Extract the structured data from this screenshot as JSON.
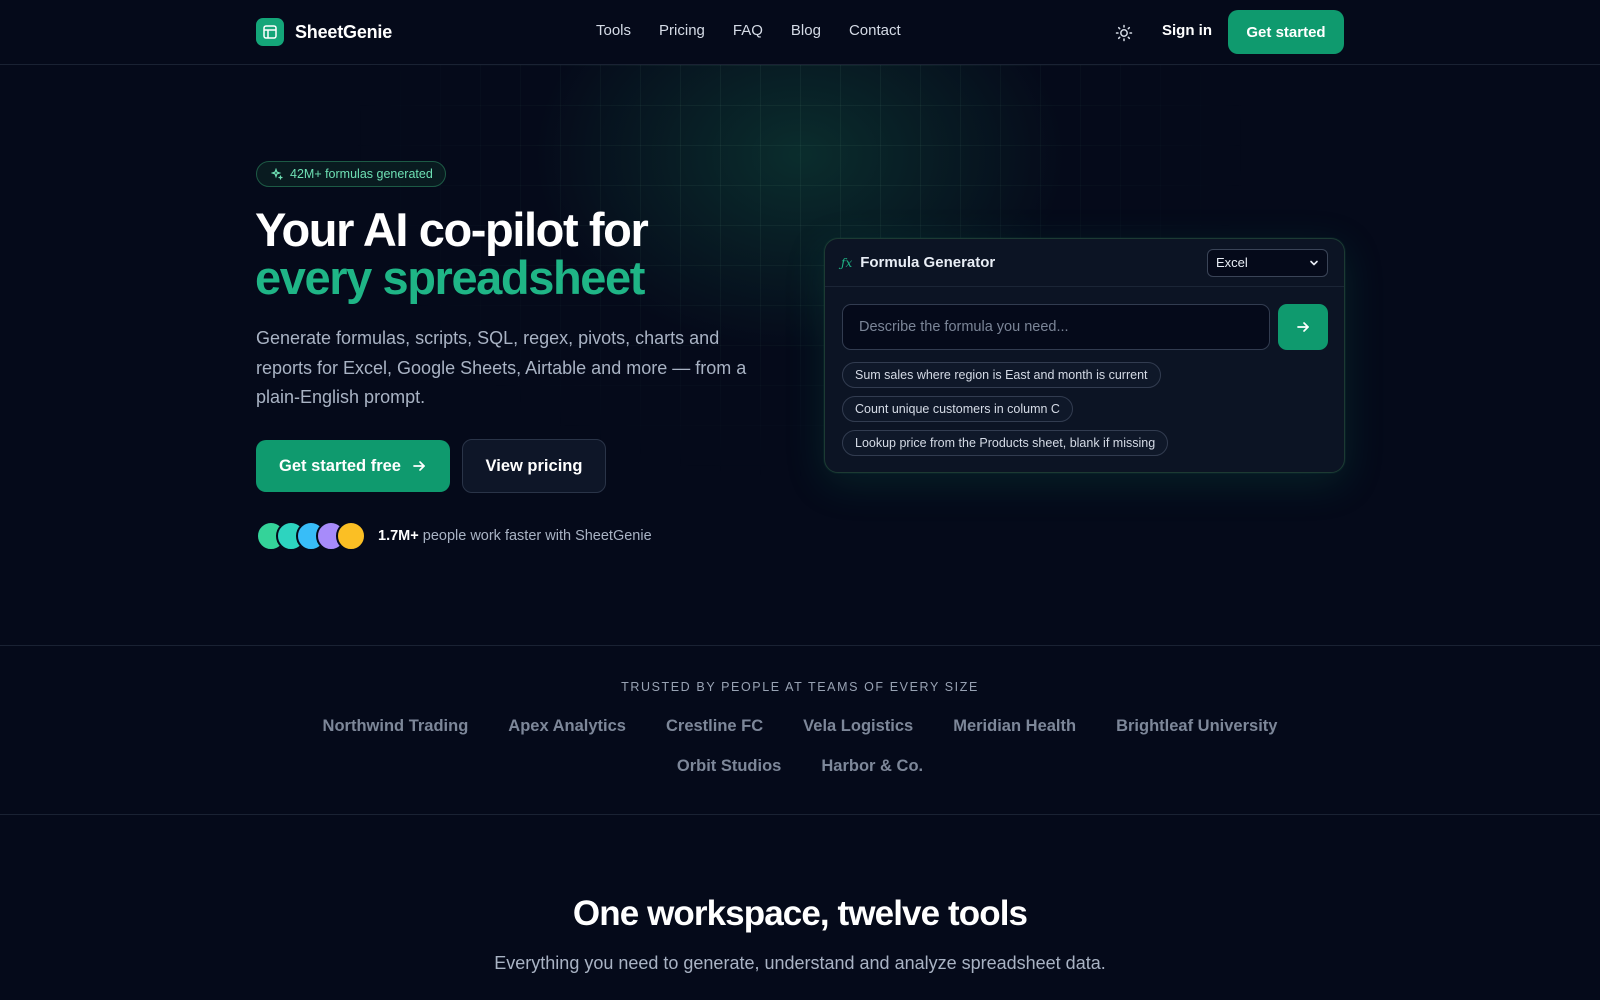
{
  "brand": {
    "name": "SheetGenie",
    "accent": "#0f9a6e",
    "accent_light": "#1fb586",
    "icon": "spreadsheet-icon"
  },
  "nav": {
    "links": [
      "Tools",
      "Pricing",
      "FAQ",
      "Blog",
      "Contact"
    ],
    "theme_icon": "sun-icon",
    "sign_in": "Sign in",
    "cta": "Get started"
  },
  "hero": {
    "badge": "42M+ formulas generated",
    "badge_icon": "sparkles-icon",
    "title_line1": "Your AI co-pilot for",
    "title_line2": "every spreadsheet",
    "subtitle": "Generate formulas, scripts, SQL, regex, pivots, charts and reports for Excel, Google Sheets, Airtable and more — from a plain-English prompt.",
    "primary_cta": "Get started free",
    "secondary_cta": "View pricing",
    "social_count": "1.7M+",
    "social_text": "people work faster with SheetGenie",
    "avatar_colors": [
      "#34d399",
      "#2dd4bf",
      "#38bdf8",
      "#a78bfa",
      "#fbbf24"
    ]
  },
  "formula_card": {
    "title": "Formula Generator",
    "icon": "fx-icon",
    "platform": "Excel",
    "placeholder": "Describe the formula you need...",
    "examples": [
      "Sum sales where region is East and month is current",
      "Count unique customers in column C",
      "Lookup price from the Products sheet, blank if missing"
    ]
  },
  "trusted": {
    "label": "TRUSTED BY PEOPLE AT TEAMS OF EVERY SIZE",
    "companies": [
      "Northwind Trading",
      "Apex Analytics",
      "Crestline FC",
      "Vela Logistics",
      "Meridian Health",
      "Brightleaf University",
      "Orbit Studios",
      "Harbor & Co."
    ]
  },
  "tools_section": {
    "title": "One workspace, twelve tools",
    "subtitle": "Everything you need to generate, understand and analyze spreadsheet data."
  }
}
